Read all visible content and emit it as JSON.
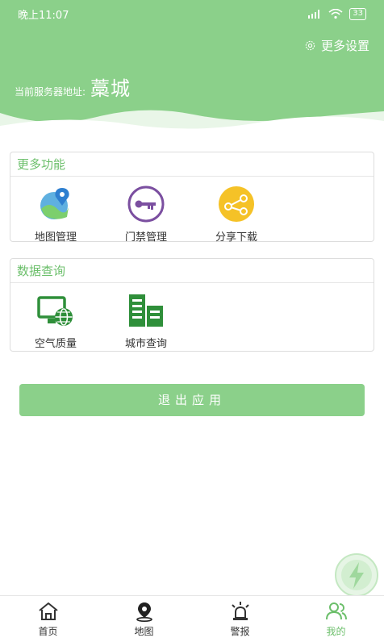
{
  "status_bar": {
    "time": "晚上11:07",
    "battery": "33"
  },
  "header": {
    "settings_label": "更多设置",
    "server_label": "当前服务器地址:",
    "server_value": "藁城"
  },
  "more_functions": {
    "title": "更多功能",
    "items": [
      {
        "label": "地图管理",
        "icon": "map-pin-icon"
      },
      {
        "label": "门禁管理",
        "icon": "key-icon"
      },
      {
        "label": "分享下载",
        "icon": "share-icon"
      }
    ]
  },
  "data_query": {
    "title": "数据查询",
    "items": [
      {
        "label": "空气质量",
        "icon": "monitor-globe-icon"
      },
      {
        "label": "城市查询",
        "icon": "buildings-icon"
      }
    ]
  },
  "logout_label": "退出应用",
  "tabs": [
    {
      "label": "首页",
      "icon": "home-icon"
    },
    {
      "label": "地图",
      "icon": "location-icon"
    },
    {
      "label": "警报",
      "icon": "alarm-icon"
    },
    {
      "label": "我的",
      "icon": "user-icon"
    }
  ],
  "colors": {
    "primary": "#8bd08a",
    "accent_text": "#6cbf6b"
  }
}
